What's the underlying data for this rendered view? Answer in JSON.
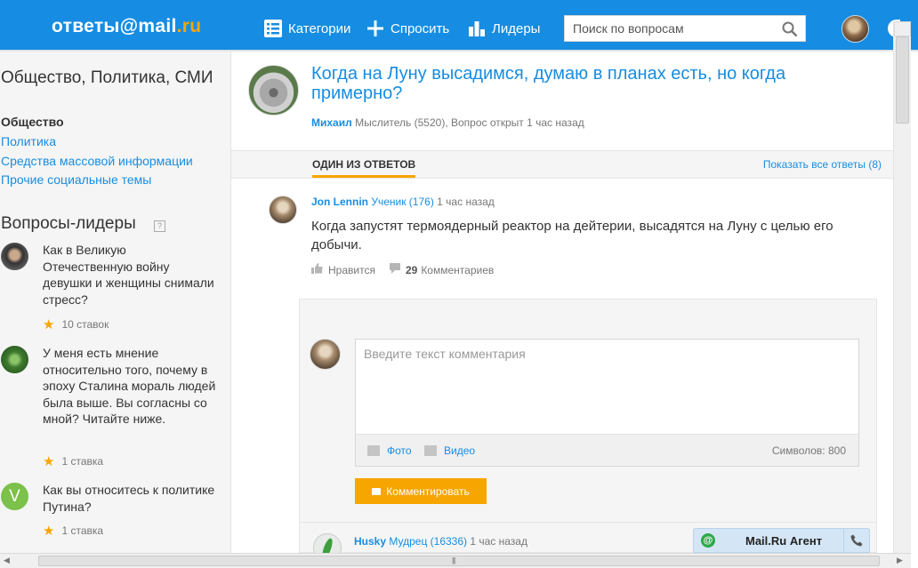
{
  "header": {
    "logo_text": "ответы",
    "logo_at": "@mail",
    "logo_ru": ".ru",
    "nav": [
      {
        "label": "Категории",
        "icon": "list-icon"
      },
      {
        "label": "Спросить",
        "icon": "plus-icon"
      },
      {
        "label": "Лидеры",
        "icon": "bar-chart-icon"
      }
    ],
    "search_placeholder": "Поиск по вопросам"
  },
  "sidebar": {
    "category_title": "Общество, Политика, СМИ",
    "current_subcategory": "Общество",
    "links": [
      "Политика",
      "Средства массовой информации",
      "Прочие социальные темы"
    ],
    "leaders_title": "Вопросы-лидеры",
    "help_label": "?",
    "leaders": [
      {
        "question": "Как в Великую Отечественную войну девушки и женщины снимали стресс?",
        "bets": "10 ставок"
      },
      {
        "question": "У меня есть мнение относительно того, почему в эпоху Сталина мораль людей была выше. Вы согласны со мной? Читайте ниже.",
        "bets": "1 ставка"
      },
      {
        "question": "Как вы относитесь к политике Путина?",
        "bets": "1 ставка",
        "avatar_letter": "V"
      }
    ]
  },
  "question": {
    "title": "Когда на Луну высадимся, думаю в планах есть, но когда примерно?",
    "author": "Михаил",
    "meta": "Мыслитель (5520), Вопрос открыт 1 час назад"
  },
  "answers_bar": {
    "tab_label": "ОДИН ИЗ ОТВЕТОВ",
    "show_all": "Показать все ответы (8)"
  },
  "answer": {
    "author": "Jon Lennin",
    "rank": "Ученик (176)",
    "time": "1 час назад",
    "text": "Когда запустят термоядерный реактор на дейтерии, высадятся на Луну с целью его добычи.",
    "like_label": "Нравится",
    "comments_count": "29",
    "comments_label": "Комментариев"
  },
  "comment_form": {
    "placeholder": "Введите текст комментария",
    "photo_label": "Фото",
    "video_label": "Видео",
    "chars_label": "Символов: 800",
    "submit_label": "Комментировать"
  },
  "next_answer": {
    "author": "Husky",
    "rank": "Мудрец (16336)",
    "time": "1 час назад"
  },
  "agent": {
    "label": "Mail.Ru Агент",
    "at": "@"
  },
  "colors": {
    "brand_blue": "#168de2",
    "accent_orange": "#f7a500",
    "agent_green": "#2ea84a"
  }
}
